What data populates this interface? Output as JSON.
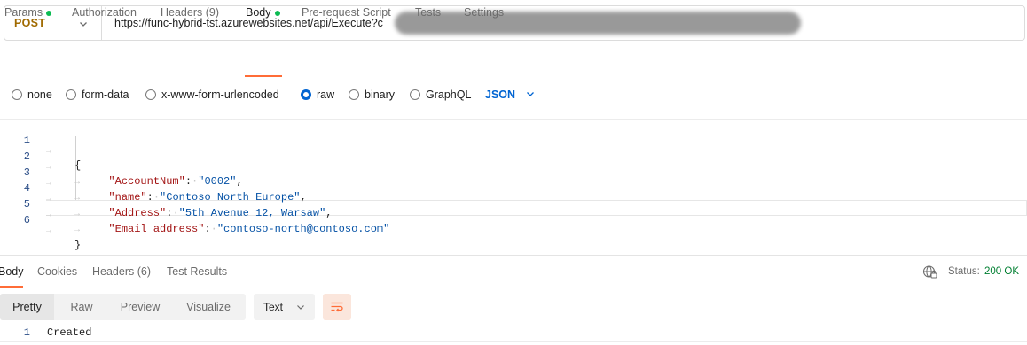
{
  "request": {
    "method": "POST",
    "url": "https://func-hybrid-tst.azurewebsites.net/api/Execute?c"
  },
  "request_tabs": [
    {
      "label": "Params",
      "dot": true
    },
    {
      "label": "Authorization"
    },
    {
      "label": "Headers",
      "count": "(9)"
    },
    {
      "label": "Body",
      "dot": true,
      "active": true
    },
    {
      "label": "Pre-request Script"
    },
    {
      "label": "Tests"
    },
    {
      "label": "Settings"
    }
  ],
  "body_types": [
    {
      "label": "none",
      "checked": false
    },
    {
      "label": "form-data",
      "checked": false
    },
    {
      "label": "x-www-form-urlencoded",
      "checked": false
    },
    {
      "label": "raw",
      "checked": true
    },
    {
      "label": "binary",
      "checked": false
    },
    {
      "label": "GraphQL",
      "checked": false
    }
  ],
  "format_select": "JSON",
  "editor": {
    "line_numbers": [
      "1",
      "2",
      "3",
      "4",
      "5",
      "6"
    ],
    "open_brace": "{",
    "close_brace": "}",
    "fields": [
      {
        "key": "\"AccountNum\"",
        "value": "\"0002\"",
        "trailing": ","
      },
      {
        "key": "\"name\"",
        "value": "\"Contoso North Europe\"",
        "trailing": ","
      },
      {
        "key": "\"Address\"",
        "value": "\"5th Avenue 12, Warsaw\"",
        "trailing": ","
      },
      {
        "key": "\"Email address\"",
        "value": "\"contoso-north@contoso.com\"",
        "trailing": ""
      }
    ]
  },
  "response_tabs": [
    {
      "label": "Body",
      "active": true
    },
    {
      "label": "Cookies"
    },
    {
      "label": "Headers (6)"
    },
    {
      "label": "Test Results"
    }
  ],
  "status": {
    "label": "Status:",
    "value": "200 OK",
    "color": "#007f31"
  },
  "view_modes": [
    "Pretty",
    "Raw",
    "Preview",
    "Visualize"
  ],
  "response_format": "Text",
  "response_body": {
    "line_number": "1",
    "text": "Created"
  },
  "colors": {
    "accent": "#ff6c37",
    "link_blue": "#0265d2",
    "method": "#a06a00",
    "dot_green": "#0cbb52"
  },
  "icons": {
    "method_dropdown": "chevron-down-icon",
    "globe": "globe-icon",
    "wrap": "wrap-lines-icon"
  }
}
